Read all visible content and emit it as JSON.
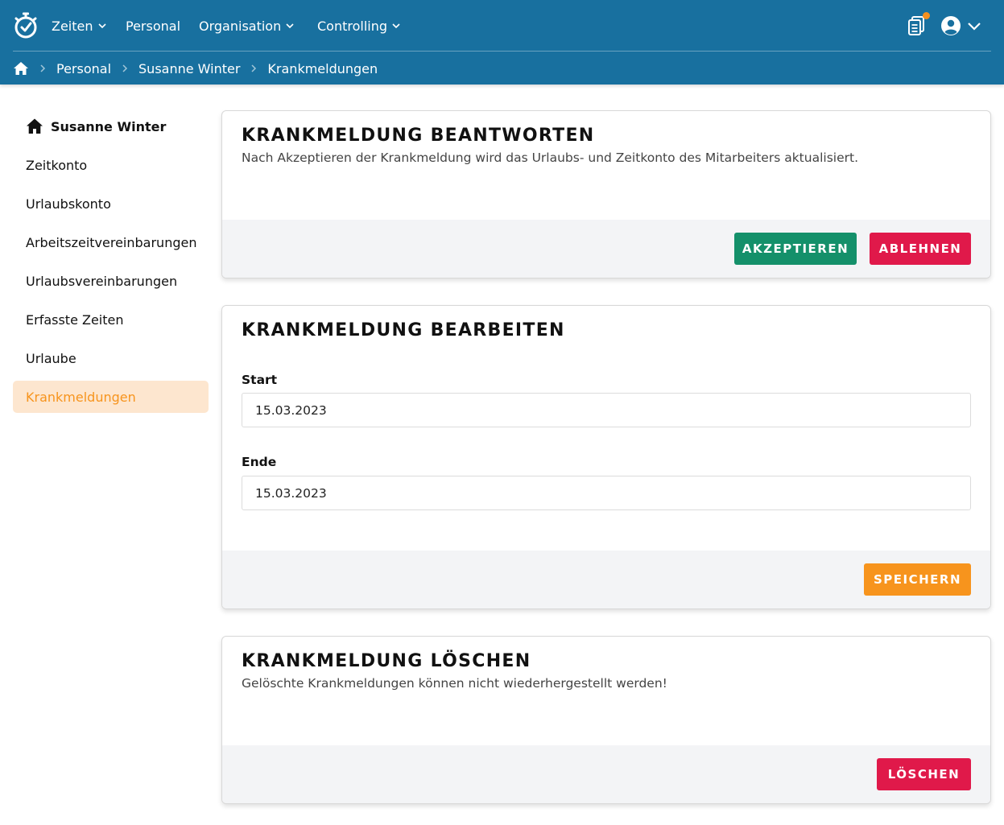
{
  "nav": {
    "items": [
      {
        "label": "Zeiten",
        "has_dropdown": true
      },
      {
        "label": "Personal",
        "has_dropdown": false
      },
      {
        "label": "Organisation",
        "has_dropdown": true
      },
      {
        "label": "Controlling",
        "has_dropdown": true
      }
    ],
    "icons": [
      "stopwatch-logo-icon",
      "clipboard-icon",
      "user-circle-icon",
      "chevron-down-icon"
    ],
    "notification_dot_color": "#f5901e"
  },
  "breadcrumb": {
    "home_icon": "home-icon",
    "items": [
      "Personal",
      "Susanne Winter",
      "Krankmeldungen"
    ]
  },
  "sidebar": {
    "title": "Susanne Winter",
    "items": [
      {
        "label": "Zeitkonto",
        "active": false
      },
      {
        "label": "Urlaubskonto",
        "active": false
      },
      {
        "label": "Arbeitszeitvereinbarungen",
        "active": false
      },
      {
        "label": "Urlaubsvereinbarungen",
        "active": false
      },
      {
        "label": "Erfasste Zeiten",
        "active": false
      },
      {
        "label": "Urlaube",
        "active": false
      },
      {
        "label": "Krankmeldungen",
        "active": true
      }
    ]
  },
  "answer": {
    "title": "KRANKMELDUNG BEANTWORTEN",
    "description": "Nach Akzeptieren der Krankmeldung wird das Urlaubs- und Zeitkonto des Mitarbeiters aktualisiert.",
    "accept_label": "AKZEPTIEREN",
    "reject_label": "ABLEHNEN"
  },
  "edit": {
    "title": "KRANKMELDUNG BEARBEITEN",
    "start_label": "Start",
    "start_value": "15.03.2023",
    "end_label": "Ende",
    "end_value": "15.03.2023",
    "save_label": "SPEICHERN"
  },
  "delete": {
    "title": "KRANKMELDUNG LÖSCHEN",
    "description": "Gelöschte Krankmeldungen können nicht wiederhergestellt werden!",
    "delete_label": "LÖSCHEN"
  },
  "colors": {
    "header": "#18709f",
    "accent": "#f7941d",
    "accept": "#14906a",
    "danger": "#e0194a",
    "active_bg": "#fde6cf"
  }
}
